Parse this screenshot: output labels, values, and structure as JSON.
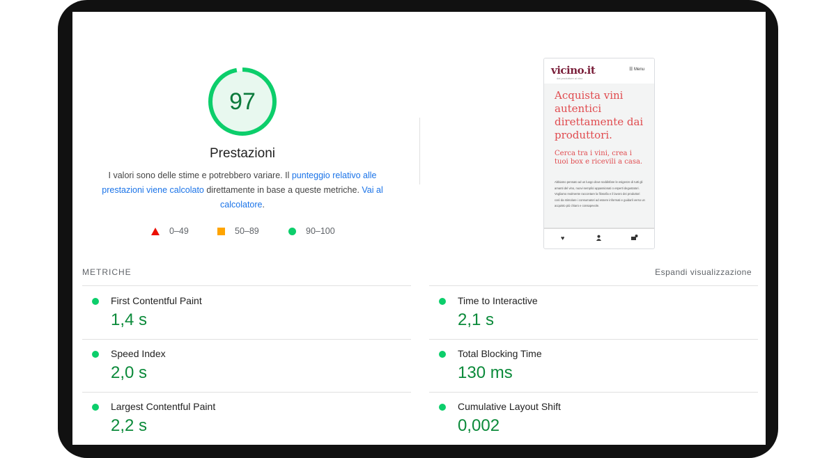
{
  "score": {
    "value": "97",
    "fraction": 0.97,
    "title": "Prestazioni",
    "color": "#0cce6b"
  },
  "description": {
    "part1": "I valori sono delle stime e potrebbero variare. Il ",
    "link1": "punteggio relativo alle prestazioni viene calcolato",
    "part2": " direttamente in base a queste metriche. ",
    "link2": "Vai al calcolatore",
    "part3": "."
  },
  "legend": [
    {
      "icon": "triangle-icon",
      "label": "0–49",
      "color": "#eb0f00"
    },
    {
      "icon": "square-icon",
      "label": "50–89",
      "color": "#ffa400"
    },
    {
      "icon": "circle-icon",
      "label": "90–100",
      "color": "#0cce6b"
    }
  ],
  "preview": {
    "logo": "vicino.it",
    "logo_sub": "dal produttore al vino",
    "menu": "☰ Menu",
    "headline": "Acquista vini autentici direttamente dai produttori.",
    "subheadline": "Cerca tra i vini, crea i tuoi box e ricevili a casa.",
    "body": "Abbiamo pensato ad un luogo dove soddisfare le esigenze di tutti gli amanti del vino, nuovi semplici appassionati o esperti degustatori. Vogliamo realmente raccontare la filosofia e il lavoro dei produttori così da stimolare i consumatori ad essere informati e guidarli verso un acquisto più chiaro e consapevole."
  },
  "metrics_section": {
    "label": "METRICHE",
    "expand": "Espandi visualizzazione"
  },
  "metrics": [
    {
      "name": "First Contentful Paint",
      "value": "1,4 s"
    },
    {
      "name": "Time to Interactive",
      "value": "2,1 s"
    },
    {
      "name": "Speed Index",
      "value": "2,0 s"
    },
    {
      "name": "Total Blocking Time",
      "value": "130 ms"
    },
    {
      "name": "Largest Contentful Paint",
      "value": "2,2 s"
    },
    {
      "name": "Cumulative Layout Shift",
      "value": "0,002"
    }
  ]
}
